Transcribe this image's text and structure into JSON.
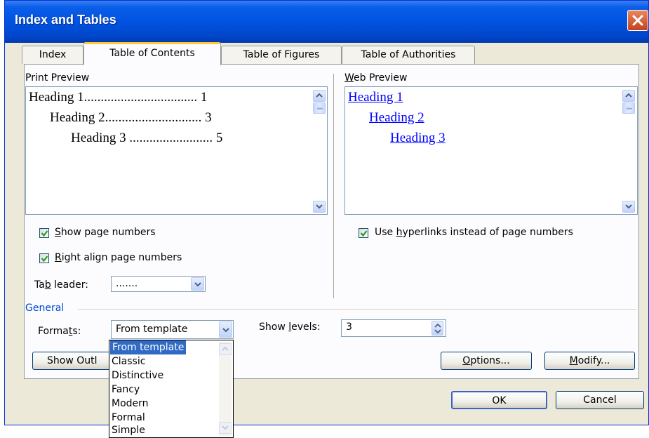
{
  "window": {
    "title": "Index and Tables"
  },
  "tabs": [
    {
      "label": "Index",
      "active": false
    },
    {
      "label": "Table of Contents",
      "active": true
    },
    {
      "label": "Table of Figures",
      "active": false
    },
    {
      "label": "Table of Authorities",
      "active": false
    }
  ],
  "print_preview": {
    "label": "Print Preview",
    "lines": [
      {
        "text": "Heading 1",
        "dots": "..................................",
        "page": "1"
      },
      {
        "text": "Heading 2",
        "dots": ".............................",
        "page": "3"
      },
      {
        "text": "Heading 3",
        "dots": ".........................",
        "page": "5"
      }
    ]
  },
  "web_preview": {
    "label": "Web Preview",
    "links": [
      "Heading 1",
      "Heading 2",
      "Heading 3"
    ]
  },
  "options": {
    "show_page_numbers": {
      "label": "Show page numbers",
      "checked": true
    },
    "right_align": {
      "label": "Right align page numbers",
      "checked": true
    },
    "use_hyperlinks": {
      "label": "Use hyperlinks instead of page numbers",
      "checked": true
    },
    "tab_leader": {
      "label": "Tab leader:",
      "value": "......."
    }
  },
  "general": {
    "label": "General",
    "formats_label": "Formats:",
    "formats_value": "From template",
    "formats_options": [
      "From template",
      "Classic",
      "Distinctive",
      "Fancy",
      "Modern",
      "Formal",
      "Simple"
    ],
    "show_levels_label": "Show levels:",
    "show_levels_value": "3"
  },
  "buttons": {
    "show_outlining": "Show Outl",
    "options": "Options...",
    "modify": "Modify...",
    "ok": "OK",
    "cancel": "Cancel"
  },
  "colors": {
    "titlebar": "#0053e1",
    "selection": "#316ac5",
    "link": "#0000ff",
    "tab_highlight": "#ffc83c"
  }
}
